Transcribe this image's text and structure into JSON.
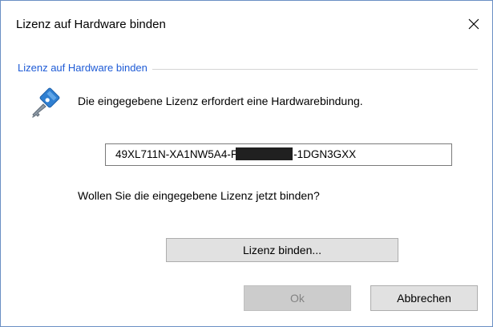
{
  "window": {
    "title": "Lizenz auf Hardware binden",
    "close_glyph": "✕"
  },
  "group": {
    "legend": "Lizenz auf Hardware binden"
  },
  "content": {
    "icon": "key-icon",
    "message": "Die eingegebene Lizenz erfordert eine Hardwarebindung.",
    "license_prefix": "49XL711N-XA1NW5A4-F",
    "license_suffix": "-1DGN3GXX",
    "question": "Wollen Sie die eingegebene Lizenz jetzt binden?"
  },
  "buttons": {
    "bind": "Lizenz binden...",
    "ok": "Ok",
    "cancel": "Abbrechen"
  },
  "colors": {
    "legend": "#1e5bd6",
    "border": "#6a8fc4",
    "button_bg": "#e1e1e1",
    "button_disabled_bg": "#cccccc"
  }
}
